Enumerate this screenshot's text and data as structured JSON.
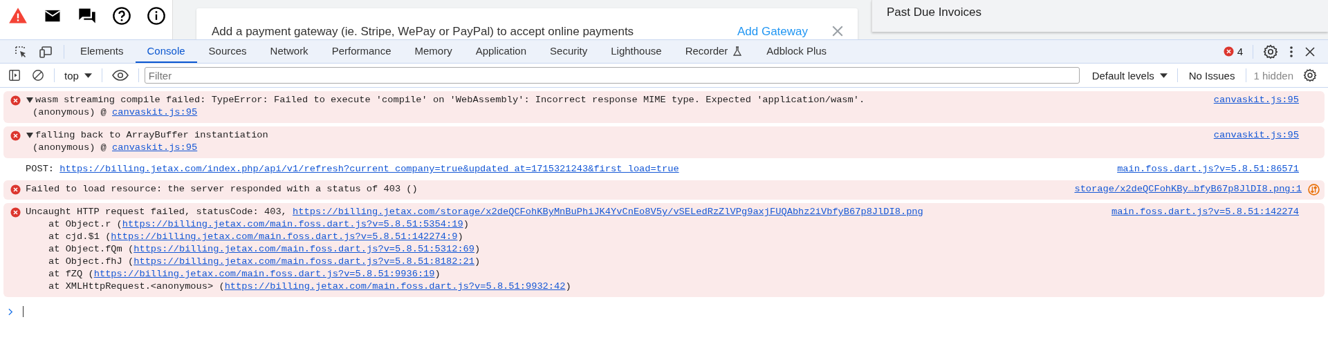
{
  "page": {
    "banner": {
      "text": "Add a payment gateway (ie. Stripe, WePay or PayPal) to accept online payments",
      "action": "Add Gateway"
    },
    "side_card": {
      "title": "Past Due Invoices"
    }
  },
  "devtools": {
    "tabs": [
      {
        "label": "Elements",
        "selected": false
      },
      {
        "label": "Console",
        "selected": true
      },
      {
        "label": "Sources",
        "selected": false
      },
      {
        "label": "Network",
        "selected": false
      },
      {
        "label": "Performance",
        "selected": false
      },
      {
        "label": "Memory",
        "selected": false
      },
      {
        "label": "Application",
        "selected": false
      },
      {
        "label": "Security",
        "selected": false
      },
      {
        "label": "Lighthouse",
        "selected": false
      },
      {
        "label": "Recorder",
        "selected": false,
        "experimental": true
      },
      {
        "label": "Adblock Plus",
        "selected": false
      }
    ],
    "error_count": "4",
    "toolbar": {
      "context": "top",
      "filter_placeholder": "Filter",
      "levels": "Default levels",
      "issues": "No Issues",
      "hidden": "1 hidden"
    },
    "messages": [
      {
        "kind": "error",
        "expanded": true,
        "parts": [
          {
            "text": "wasm streaming compile failed: TypeError: Failed to execute 'compile' on 'WebAssembly': Incorrect response MIME type. Expected 'application/wasm'.",
            "link": false
          }
        ],
        "source": "canvaskit.js:95",
        "stack": [
          [
            {
              "text": "(anonymous) @ ",
              "link": false
            },
            {
              "text": "canvaskit.js:95",
              "link": true
            }
          ]
        ]
      },
      {
        "kind": "error",
        "expanded": true,
        "parts": [
          {
            "text": "falling back to ArrayBuffer instantiation",
            "link": false
          }
        ],
        "source": "canvaskit.js:95",
        "stack": [
          [
            {
              "text": "(anonymous) @ ",
              "link": false
            },
            {
              "text": "canvaskit.js:95",
              "link": true
            }
          ]
        ]
      },
      {
        "kind": "log",
        "parts": [
          {
            "text": "POST: ",
            "link": false
          },
          {
            "text": "https://billing.jetax.com/index.php/api/v1/refresh?current_company=true&updated_at=1715321243&first_load=true",
            "link": true
          }
        ],
        "source": "main.foss.dart.js?v=5.8.51:86571"
      },
      {
        "kind": "error",
        "network_request": true,
        "parts": [
          {
            "text": "Failed to load resource: the server responded with a status of 403 ()",
            "link": false
          }
        ],
        "source": "storage/x2deQCFohKBy…bfyB67p8JlDI8.png:1"
      },
      {
        "kind": "error",
        "parts": [
          {
            "text": "Uncaught HTTP request failed, statusCode: 403, ",
            "link": false
          },
          {
            "text": "https://billing.jetax.com/storage/x2deQCFohKByMnBuPhiJK4YvCnEo8V5y/vSELedRzZlVPg9axjFUQAbhz2iVbfyB67p8JlDI8.png",
            "link": true
          }
        ],
        "source": "main.foss.dart.js?v=5.8.51:142274",
        "stack": [
          [
            {
              "text": "at Object.r (",
              "link": false
            },
            {
              "text": "https://billing.jetax.com/main.foss.dart.js?v=5.8.51:5354:19",
              "link": true
            },
            {
              "text": ")",
              "link": false
            }
          ],
          [
            {
              "text": "at cjd.$1 (",
              "link": false
            },
            {
              "text": "https://billing.jetax.com/main.foss.dart.js?v=5.8.51:142274:9",
              "link": true
            },
            {
              "text": ")",
              "link": false
            }
          ],
          [
            {
              "text": "at Object.fQm (",
              "link": false
            },
            {
              "text": "https://billing.jetax.com/main.foss.dart.js?v=5.8.51:5312:69",
              "link": true
            },
            {
              "text": ")",
              "link": false
            }
          ],
          [
            {
              "text": "at Object.fhJ (",
              "link": false
            },
            {
              "text": "https://billing.jetax.com/main.foss.dart.js?v=5.8.51:8182:21",
              "link": true
            },
            {
              "text": ")",
              "link": false
            }
          ],
          [
            {
              "text": "at fZQ (",
              "link": false
            },
            {
              "text": "https://billing.jetax.com/main.foss.dart.js?v=5.8.51:9936:19",
              "link": true
            },
            {
              "text": ")",
              "link": false
            }
          ],
          [
            {
              "text": "at XMLHttpRequest.<anonymous> (",
              "link": false
            },
            {
              "text": "https://billing.jetax.com/main.foss.dart.js?v=5.8.51:9932:42",
              "link": true
            },
            {
              "text": ")",
              "link": false
            }
          ]
        ]
      }
    ]
  }
}
